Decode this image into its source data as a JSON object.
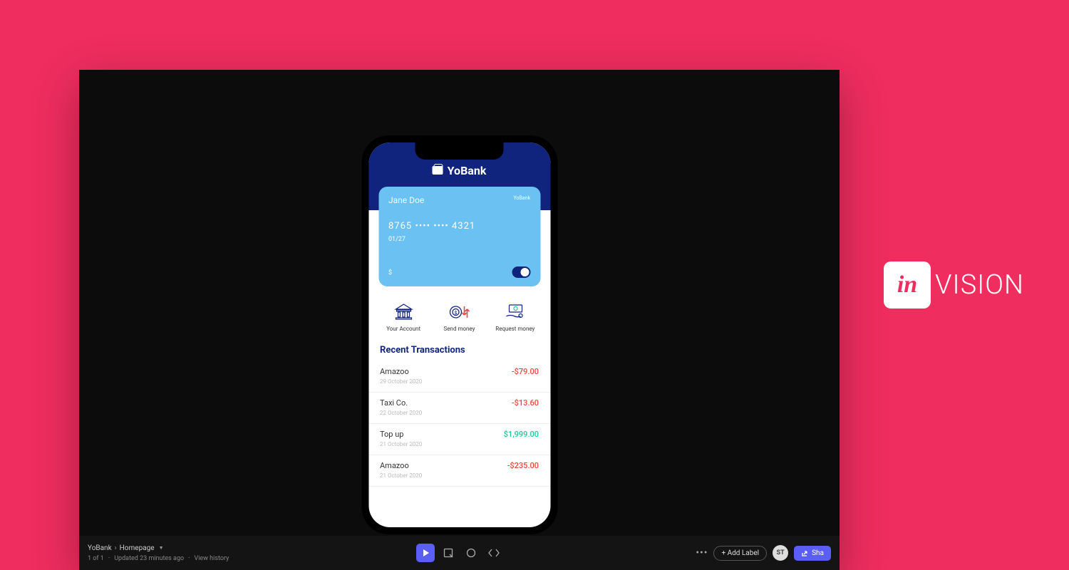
{
  "logo": {
    "badge": "in",
    "text": "VISION"
  },
  "breadcrumb": {
    "project": "YoBank",
    "page": "Homepage"
  },
  "meta": {
    "count": "1 of 1",
    "updated": "Updated 23 minutes ago",
    "history": "View history"
  },
  "toolbar": {
    "addLabel": "+ Add Label",
    "avatar": "ST",
    "share": "Sha"
  },
  "app": {
    "name": "YoBank",
    "card": {
      "holder": "Jane Doe",
      "brand": "YoBank",
      "number": "8765 •••• •••• 4321",
      "expiry": "01/27",
      "currency": "$"
    },
    "actions": [
      {
        "label": "Your Account"
      },
      {
        "label": "Send money"
      },
      {
        "label": "Request money"
      }
    ],
    "sectionTitle": "Recent Transactions",
    "transactions": [
      {
        "name": "Amazoo",
        "date": "29 October 2020",
        "amount": "-$79.00",
        "type": "neg"
      },
      {
        "name": "Taxi Co.",
        "date": "22 October 2020",
        "amount": "-$13.60",
        "type": "neg"
      },
      {
        "name": "Top up",
        "date": "21 October 2020",
        "amount": "$1,999.00",
        "type": "pos"
      },
      {
        "name": "Amazoo",
        "date": "21 October 2020",
        "amount": "-$235.00",
        "type": "neg"
      }
    ]
  }
}
